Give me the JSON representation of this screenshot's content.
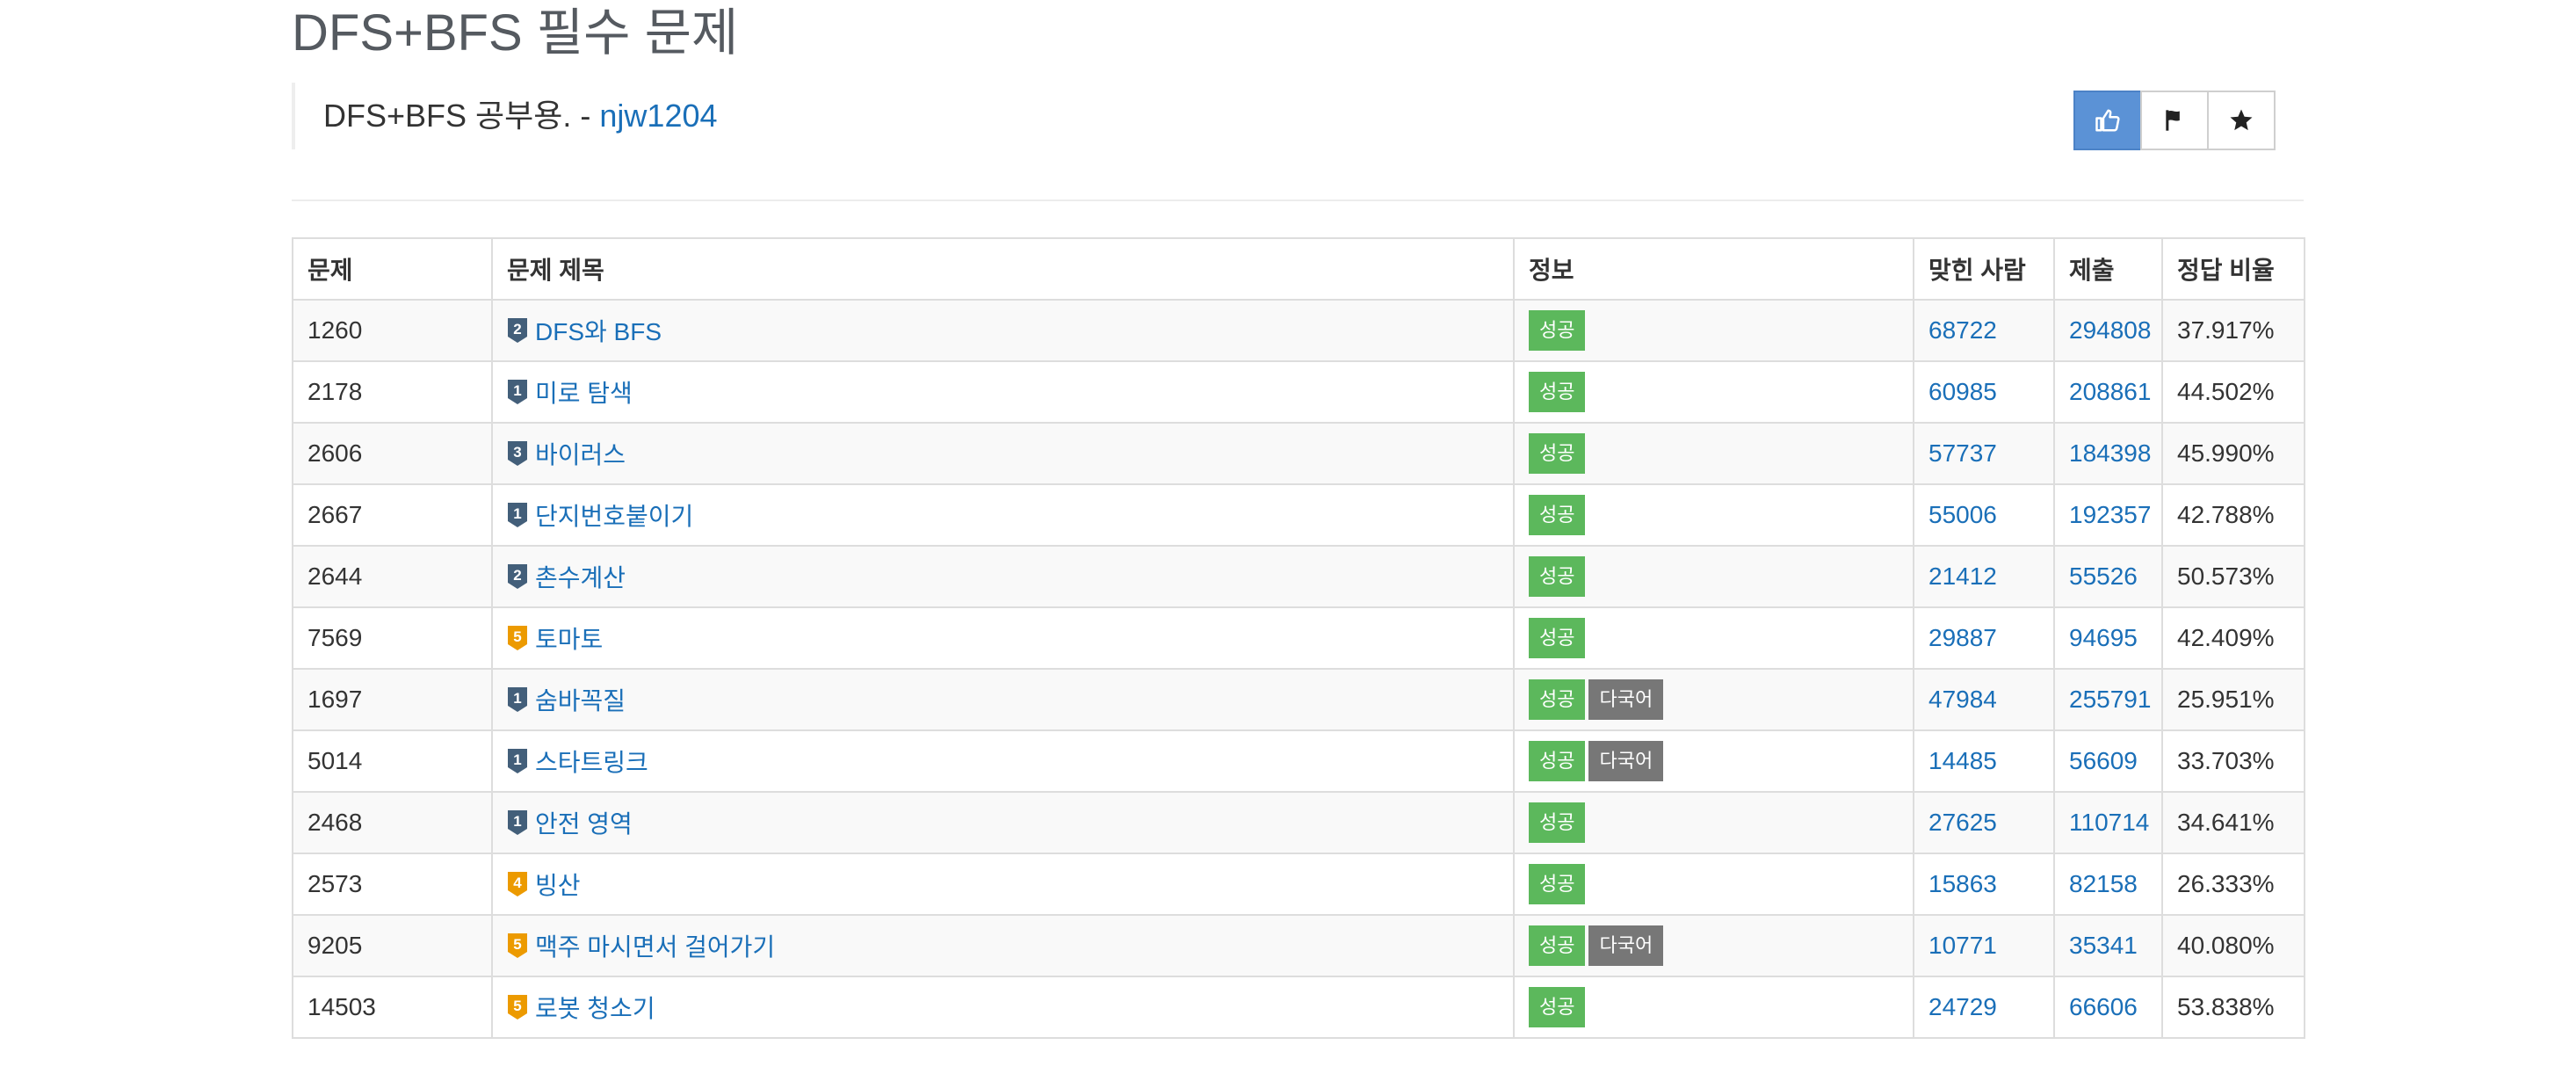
{
  "page": {
    "title": "DFS+BFS 필수 문제",
    "description_prefix": "DFS+BFS 공부용. - ",
    "author": "njw1204"
  },
  "actions": {
    "like_icon": "thumbs-up-icon",
    "flag_icon": "flag-icon",
    "star_icon": "star-icon",
    "active_color": "#5b92d6"
  },
  "table": {
    "headers": {
      "id": "문제",
      "title": "문제 제목",
      "info": "정보",
      "solved": "맞힌 사람",
      "submit": "제출",
      "ratio": "정답 비율"
    },
    "rows": [
      {
        "id": "1260",
        "tier": "silver",
        "tier_num": "2",
        "title": "DFS와 BFS",
        "labels": [
          "성공"
        ],
        "solved": "68722",
        "submit": "294808",
        "ratio": "37.917%"
      },
      {
        "id": "2178",
        "tier": "silver",
        "tier_num": "1",
        "title": "미로 탐색",
        "labels": [
          "성공"
        ],
        "solved": "60985",
        "submit": "208861",
        "ratio": "44.502%"
      },
      {
        "id": "2606",
        "tier": "silver",
        "tier_num": "3",
        "title": "바이러스",
        "labels": [
          "성공"
        ],
        "solved": "57737",
        "submit": "184398",
        "ratio": "45.990%"
      },
      {
        "id": "2667",
        "tier": "silver",
        "tier_num": "1",
        "title": "단지번호붙이기",
        "labels": [
          "성공"
        ],
        "solved": "55006",
        "submit": "192357",
        "ratio": "42.788%"
      },
      {
        "id": "2644",
        "tier": "silver",
        "tier_num": "2",
        "title": "촌수계산",
        "labels": [
          "성공"
        ],
        "solved": "21412",
        "submit": "55526",
        "ratio": "50.573%"
      },
      {
        "id": "7569",
        "tier": "gold",
        "tier_num": "5",
        "title": "토마토",
        "labels": [
          "성공"
        ],
        "solved": "29887",
        "submit": "94695",
        "ratio": "42.409%"
      },
      {
        "id": "1697",
        "tier": "silver",
        "tier_num": "1",
        "title": "숨바꼭질",
        "labels": [
          "성공",
          "다국어"
        ],
        "solved": "47984",
        "submit": "255791",
        "ratio": "25.951%"
      },
      {
        "id": "5014",
        "tier": "silver",
        "tier_num": "1",
        "title": "스타트링크",
        "labels": [
          "성공",
          "다국어"
        ],
        "solved": "14485",
        "submit": "56609",
        "ratio": "33.703%"
      },
      {
        "id": "2468",
        "tier": "silver",
        "tier_num": "1",
        "title": "안전 영역",
        "labels": [
          "성공"
        ],
        "solved": "27625",
        "submit": "110714",
        "ratio": "34.641%"
      },
      {
        "id": "2573",
        "tier": "gold",
        "tier_num": "4",
        "title": "빙산",
        "labels": [
          "성공"
        ],
        "solved": "15863",
        "submit": "82158",
        "ratio": "26.333%"
      },
      {
        "id": "9205",
        "tier": "gold",
        "tier_num": "5",
        "title": "맥주 마시면서 걸어가기",
        "labels": [
          "성공",
          "다국어"
        ],
        "solved": "10771",
        "submit": "35341",
        "ratio": "40.080%"
      },
      {
        "id": "14503",
        "tier": "gold",
        "tier_num": "5",
        "title": "로봇 청소기",
        "labels": [
          "성공"
        ],
        "solved": "24729",
        "submit": "66606",
        "ratio": "53.838%"
      }
    ]
  },
  "colors": {
    "link": "#1a6fb8",
    "success_label": "#5cb85c",
    "multi_label": "#777777",
    "tier_silver": "#435f7a",
    "tier_gold": "#ec9a00"
  }
}
